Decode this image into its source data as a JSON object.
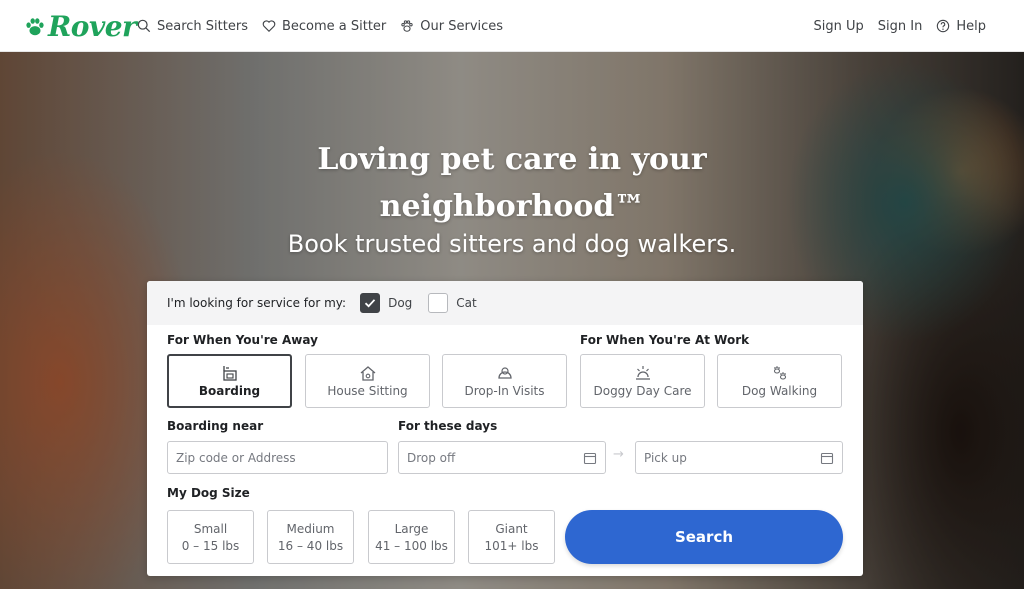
{
  "header": {
    "logo": "Rover",
    "nav_left": [
      {
        "label": "Search Sitters",
        "icon": "search-icon"
      },
      {
        "label": "Become a Sitter",
        "icon": "heart-icon"
      },
      {
        "label": "Our Services",
        "icon": "paw-icon"
      }
    ],
    "nav_right": [
      {
        "label": "Sign Up"
      },
      {
        "label": "Sign In"
      },
      {
        "label": "Help",
        "icon": "help-circle-icon"
      }
    ]
  },
  "hero": {
    "title_line1": "Loving pet care in your",
    "title_line2": "neighborhood™",
    "subtitle": "Book trusted sitters and dog walkers."
  },
  "search": {
    "pet_prompt": "I'm looking for service for my:",
    "pets": [
      {
        "label": "Dog",
        "checked": true
      },
      {
        "label": "Cat",
        "checked": false
      }
    ],
    "away_label": "For When You're Away",
    "work_label": "For When You're At Work",
    "services": [
      {
        "label": "Boarding",
        "icon": "boarding-icon",
        "selected": true
      },
      {
        "label": "House Sitting",
        "icon": "house-icon",
        "selected": false
      },
      {
        "label": "Drop-In Visits",
        "icon": "drop-in-icon",
        "selected": false
      },
      {
        "label": "Doggy Day Care",
        "icon": "sun-icon",
        "selected": false
      },
      {
        "label": "Dog Walking",
        "icon": "paw-prints-icon",
        "selected": false
      }
    ],
    "location_label": "Boarding near",
    "location_placeholder": "Zip code or Address",
    "dates_label": "For these days",
    "dropoff_placeholder": "Drop off",
    "pickup_placeholder": "Pick up",
    "date_arrow": "→",
    "size_label": "My Dog Size",
    "sizes": [
      {
        "name": "Small",
        "range": "0 – 15 lbs"
      },
      {
        "name": "Medium",
        "range": "16 – 40 lbs"
      },
      {
        "name": "Large",
        "range": "41 – 100 lbs"
      },
      {
        "name": "Giant",
        "range": "101+ lbs"
      }
    ],
    "search_button": "Search"
  },
  "colors": {
    "brand": "#1fa35b",
    "primary": "#2e67d1",
    "text": "#404347"
  }
}
